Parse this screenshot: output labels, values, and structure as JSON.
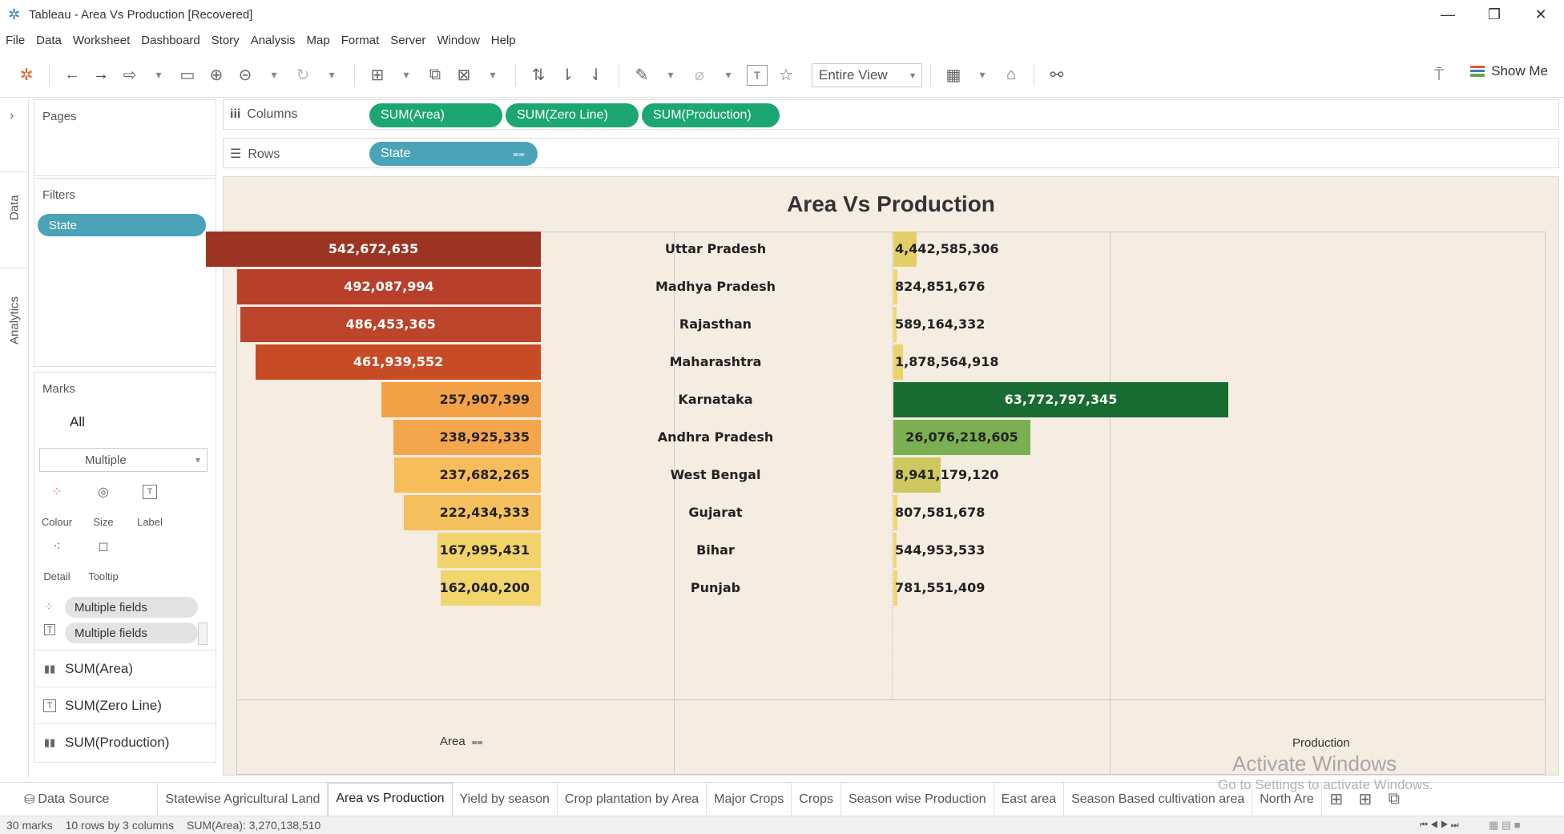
{
  "window": {
    "title": "Tableau - Area Vs Production [Recovered]"
  },
  "menu": [
    "File",
    "Data",
    "Worksheet",
    "Dashboard",
    "Story",
    "Analysis",
    "Map",
    "Format",
    "Server",
    "Window",
    "Help"
  ],
  "toolbar": {
    "view_select": "Entire View",
    "show_me": "Show Me"
  },
  "side_tabs": {
    "data": "Data",
    "analytics": "Analytics"
  },
  "pages": {
    "title": "Pages"
  },
  "filters": {
    "title": "Filters",
    "pill": "State"
  },
  "marks": {
    "title": "Marks",
    "all_label": "All",
    "type_select": "Multiple",
    "buttons": {
      "colour": "Colour",
      "size": "Size",
      "label": "Label",
      "detail": "Detail",
      "tooltip": "Tooltip"
    },
    "field_pills": [
      "Multiple fields",
      "Multiple fields"
    ],
    "measures": [
      "SUM(Area)",
      "SUM(Zero Line)",
      "SUM(Production)"
    ]
  },
  "shelves": {
    "columns_label": "Columns",
    "rows_label": "Rows",
    "columns_pills": [
      "SUM(Area)",
      "SUM(Zero Line)",
      "SUM(Production)"
    ],
    "rows_pill": "State"
  },
  "chart_data": {
    "type": "bar",
    "title": "Area Vs Production",
    "categories": [
      "Uttar Pradesh",
      "Madhya Pradesh",
      "Rajasthan",
      "Maharashtra",
      "Karnataka",
      "Andhra Pradesh",
      "West Bengal",
      "Gujarat",
      "Bihar",
      "Punjab"
    ],
    "series": [
      {
        "name": "Area",
        "values": [
          542672635,
          492087994,
          486453365,
          461939552,
          257907399,
          238925335,
          237682265,
          222434333,
          167995431,
          162040200
        ],
        "labels": [
          "542,672,635",
          "492,087,994",
          "486,453,365",
          "461,939,552",
          "257,907,399",
          "238,925,335",
          "237,682,265",
          "222,434,333",
          "167,995,431",
          "162,040,200"
        ],
        "colors": [
          "#9b3423",
          "#b8402a",
          "#bc442a",
          "#c74b25",
          "#f3a146",
          "#f4a64c",
          "#f6bd5a",
          "#f5c15e",
          "#f3d36c",
          "#f2d56c"
        ],
        "direction": "left"
      },
      {
        "name": "Production",
        "values": [
          4442585306,
          824851676,
          589164332,
          1878564918,
          63772797345,
          26076218605,
          8941179120,
          807581678,
          544953533,
          781551409
        ],
        "labels": [
          "4,442,585,306",
          "824,851,676",
          "589,164,332",
          "1,878,564,918",
          "63,772,797,345",
          "26,076,218,605",
          "8,941,179,120",
          "807,581,678",
          "544,953,533",
          "781,551,409"
        ],
        "colors": [
          "#e3cf67",
          "#f1d66e",
          "#f1d66e",
          "#ead46a",
          "#186b31",
          "#7ab052",
          "#cdc860",
          "#f1d66e",
          "#f1d66e",
          "#f1d66e"
        ],
        "direction": "right"
      }
    ],
    "xlabel_left": "Area",
    "xlabel_right": "Production"
  },
  "sheet_tabs": [
    "Data Source",
    "Statewise Agricultural Land",
    "Area vs Production",
    "Yield by season",
    "Crop plantation by Area",
    "Major Crops",
    "Crops",
    "Season wise Production",
    "East area",
    "Season Based cultivation area",
    "North Are"
  ],
  "active_tab": "Area vs Production",
  "status": {
    "marks": "30 marks",
    "shape": "10 rows by 3 columns",
    "sum": "SUM(Area): 3,270,138,510"
  },
  "watermark": {
    "line1": "Activate Windows",
    "line2": "Go to Settings to activate Windows."
  }
}
